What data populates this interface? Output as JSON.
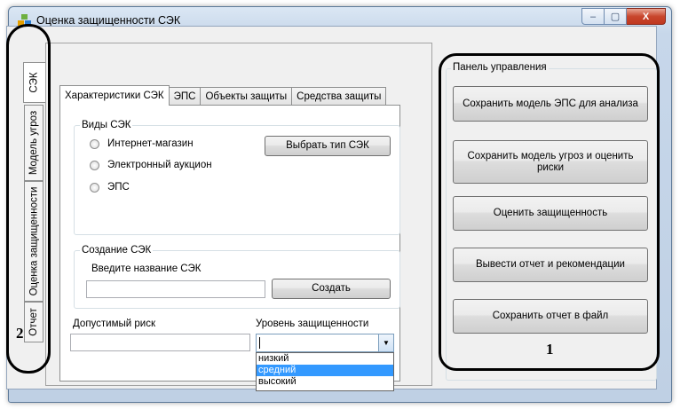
{
  "window": {
    "title": "Оценка защищенности СЭК",
    "controls": {
      "minimize": "‒",
      "maximize": "▢",
      "close": "X"
    }
  },
  "side_tabs": [
    {
      "label": "СЭК",
      "active": true
    },
    {
      "label": "Модель угроз",
      "active": false
    },
    {
      "label": "Оценка защищенности",
      "active": false
    },
    {
      "label": "Отчет",
      "active": false
    }
  ],
  "tabs": [
    {
      "label": "Характеристики СЭК",
      "active": true
    },
    {
      "label": "ЭПС",
      "active": false
    },
    {
      "label": "Объекты защиты",
      "active": false
    },
    {
      "label": "Средства защиты",
      "active": false
    }
  ],
  "types_group": {
    "legend": "Виды СЭК",
    "options": [
      "Интернет-магазин",
      "Электронный аукцион",
      "ЭПС"
    ],
    "select_button": "Выбрать тип СЭК"
  },
  "create_group": {
    "legend": "Создание СЭК",
    "name_label": "Введите название СЭК",
    "name_value": "",
    "create_button": "Создать"
  },
  "risk": {
    "label": "Допустимый риск",
    "value": ""
  },
  "security_level": {
    "label": "Уровень защищенности",
    "value": "",
    "options": [
      "низкий",
      "средний",
      "высокий"
    ],
    "highlighted": "средний"
  },
  "control_panel": {
    "legend": "Панель управления",
    "buttons": [
      "Сохранить модель ЭПС для анализа",
      "Сохранить модель угроз и оценить риски",
      "Оценить защищенность",
      "Вывести отчет и рекомендации",
      "Сохранить отчет в файл"
    ]
  },
  "annotations": {
    "marker_1": "1",
    "marker_2": "2"
  },
  "colors": {
    "selection": "#3399ff",
    "close_button": "#c8462d",
    "window_frame": "#bfd0e4"
  }
}
